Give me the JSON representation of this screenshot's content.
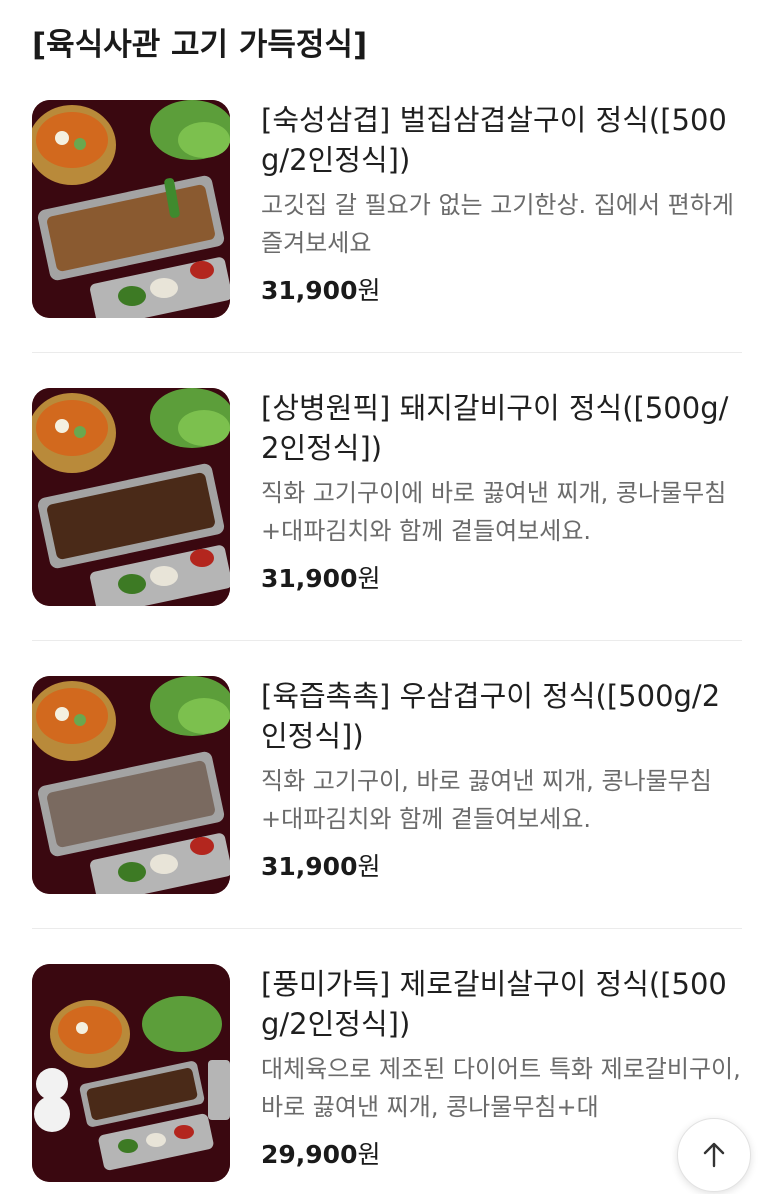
{
  "section": {
    "title": "[육식사관 고기 가득정식]"
  },
  "items": [
    {
      "name": "[숙성삼겹] 벌집삼겹살구이 정식([500g/2인정식])",
      "desc": "고깃집 갈 필요가 없는 고기한상. 집에서 편하게 즐겨보세요",
      "price": "31,900",
      "unit": "원"
    },
    {
      "name": "[상병원픽] 돼지갈비구이 정식([500g/2인정식])",
      "desc": "직화 고기구이에 바로 끓여낸 찌개, 콩나물무침+대파김치와 함께 곁들여보세요.",
      "price": "31,900",
      "unit": "원"
    },
    {
      "name": "[육즙촉촉] 우삼겹구이 정식([500g/2인정식])",
      "desc": "직화 고기구이, 바로 끓여낸 찌개, 콩나물무침+대파김치와 함께 곁들여보세요.",
      "price": "31,900",
      "unit": "원"
    },
    {
      "name": "[풍미가득] 제로갈비살구이 정식([500g/2인정식])",
      "desc": "대체육으로 제조된 다이어트 특화 제로갈비구이, 바로 끓여낸 찌개, 콩나물무침+대",
      "price": "29,900",
      "unit": "원"
    }
  ],
  "icons": {
    "scroll_top": "arrow-up-icon"
  },
  "colors": {
    "background": "#ffffff",
    "title": "#1a1a1a",
    "description": "#6b6b6b",
    "divider": "#ebebeb"
  }
}
